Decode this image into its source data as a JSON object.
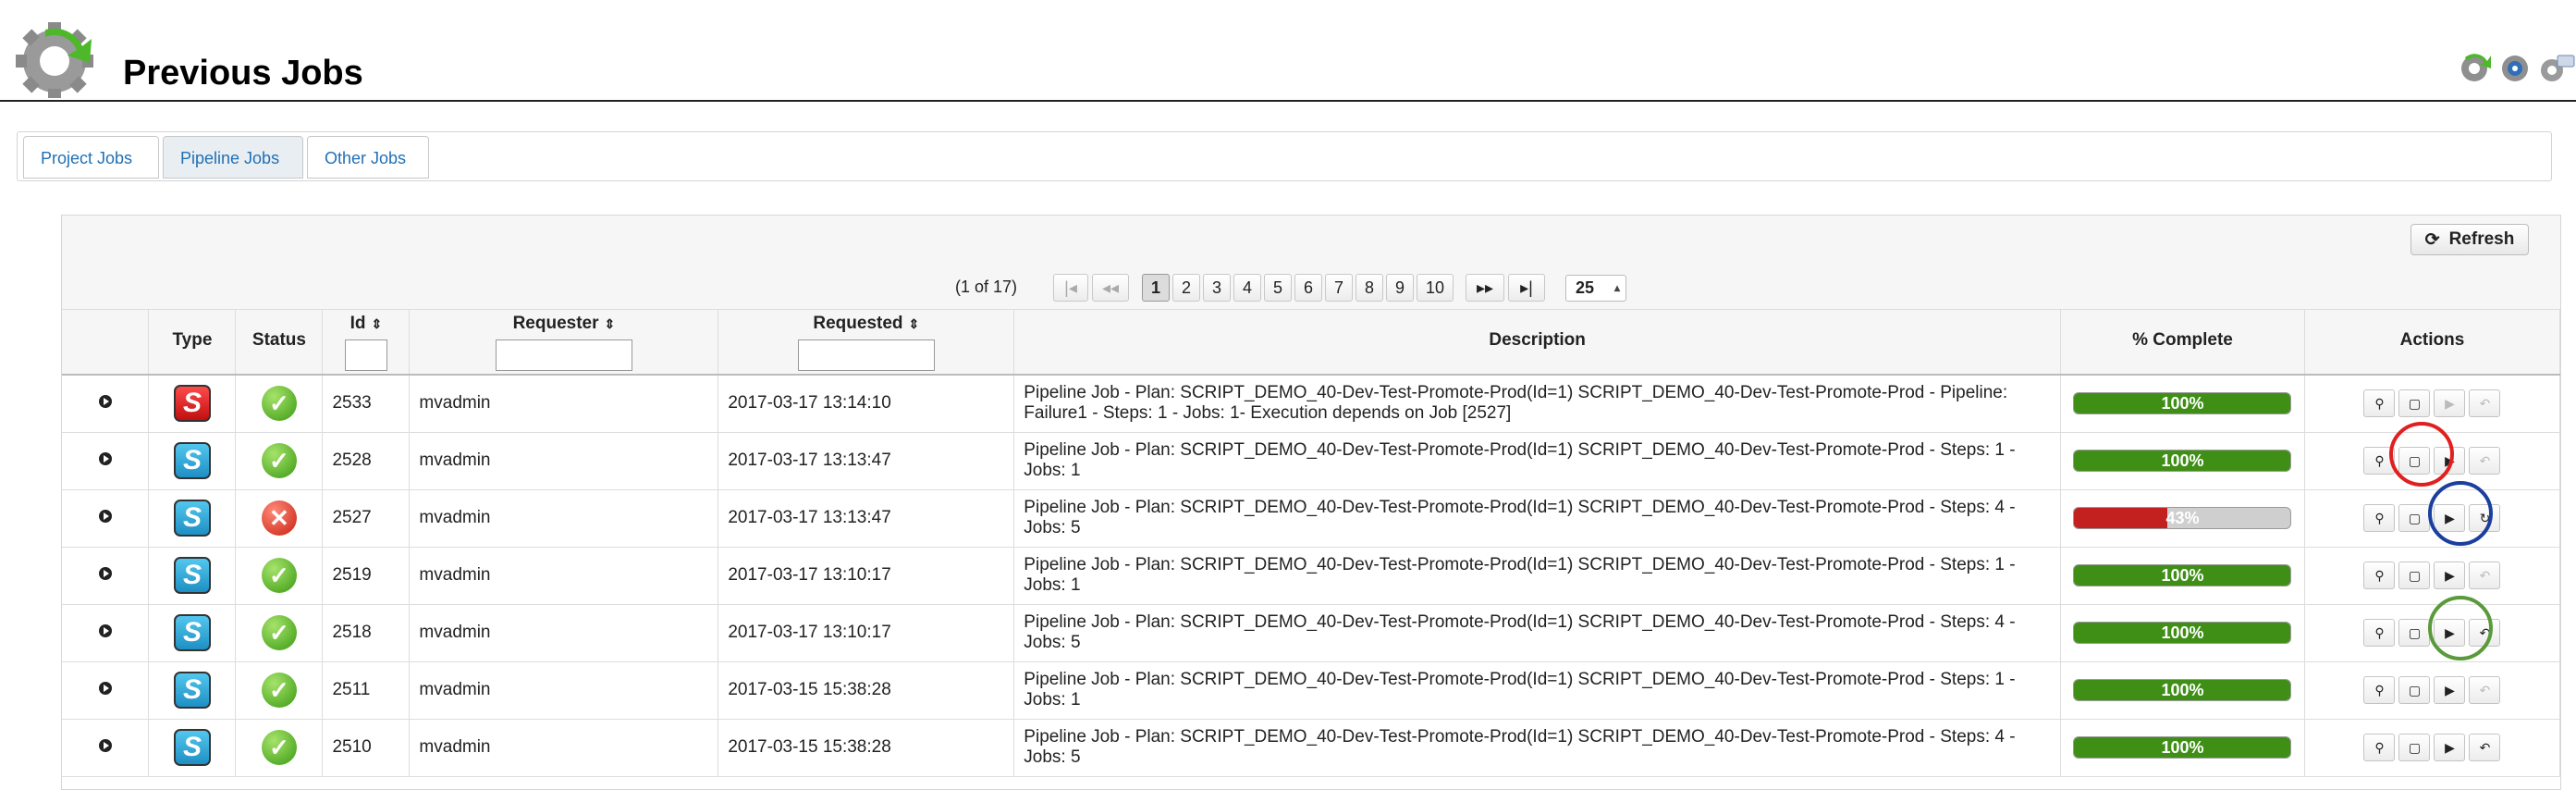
{
  "page": {
    "title": "Previous Jobs"
  },
  "tabs": [
    {
      "label": "Project Jobs",
      "active": false
    },
    {
      "label": "Pipeline Jobs",
      "active": true
    },
    {
      "label": "Other Jobs",
      "active": false
    }
  ],
  "toolbar": {
    "refresh_label": "Refresh"
  },
  "pager": {
    "report": "(1 of 17)",
    "pages": [
      "1",
      "2",
      "3",
      "4",
      "5",
      "6",
      "7",
      "8",
      "9",
      "10"
    ],
    "first": "|◂",
    "prev": "◂◂",
    "next": "▸▸",
    "last": "▸|",
    "rows_per_page": "25"
  },
  "columns": {
    "type": "Type",
    "status": "Status",
    "id": "Id",
    "requester": "Requester",
    "requested": "Requested",
    "description": "Description",
    "complete": "% Complete",
    "actions": "Actions"
  },
  "rows": [
    {
      "type_color": "red",
      "status": "ok",
      "id": "2533",
      "requester": "mvadmin",
      "requested": "2017-03-17 13:14:10",
      "description": "Pipeline Job - Plan: SCRIPT_DEMO_40-Dev-Test-Promote-Prod(Id=1) SCRIPT_DEMO_40-Dev-Test-Promote-Prod - Pipeline: Failure1 - Steps: 1 - Jobs: 1- Execution depends on Job [2527]",
      "progress_label": "100%",
      "progress": 100,
      "actions": [
        "view",
        "log",
        "run-disabled",
        "undo-disabled"
      ]
    },
    {
      "type_color": "blue",
      "status": "ok",
      "id": "2528",
      "requester": "mvadmin",
      "requested": "2017-03-17 13:13:47",
      "description": "Pipeline Job - Plan: SCRIPT_DEMO_40-Dev-Test-Promote-Prod(Id=1) SCRIPT_DEMO_40-Dev-Test-Promote-Prod - Steps: 1 - Jobs: 1",
      "progress_label": "100%",
      "progress": 100,
      "actions": [
        "view",
        "log",
        "run",
        "undo-disabled"
      ]
    },
    {
      "type_color": "blue",
      "status": "fail",
      "id": "2527",
      "requester": "mvadmin",
      "requested": "2017-03-17 13:13:47",
      "description": "Pipeline Job - Plan: SCRIPT_DEMO_40-Dev-Test-Promote-Prod(Id=1) SCRIPT_DEMO_40-Dev-Test-Promote-Prod - Steps: 4 - Jobs: 5",
      "progress_label": "43%",
      "progress": 43,
      "actions": [
        "view",
        "log",
        "run",
        "retry"
      ]
    },
    {
      "type_color": "blue",
      "status": "ok",
      "id": "2519",
      "requester": "mvadmin",
      "requested": "2017-03-17 13:10:17",
      "description": "Pipeline Job - Plan: SCRIPT_DEMO_40-Dev-Test-Promote-Prod(Id=1) SCRIPT_DEMO_40-Dev-Test-Promote-Prod - Steps: 1 - Jobs: 1",
      "progress_label": "100%",
      "progress": 100,
      "actions": [
        "view",
        "log",
        "run",
        "undo-disabled"
      ]
    },
    {
      "type_color": "blue",
      "status": "ok",
      "id": "2518",
      "requester": "mvadmin",
      "requested": "2017-03-17 13:10:17",
      "description": "Pipeline Job - Plan: SCRIPT_DEMO_40-Dev-Test-Promote-Prod(Id=1) SCRIPT_DEMO_40-Dev-Test-Promote-Prod - Steps: 4 - Jobs: 5",
      "progress_label": "100%",
      "progress": 100,
      "actions": [
        "view",
        "log",
        "run",
        "undo"
      ]
    },
    {
      "type_color": "blue",
      "status": "ok",
      "id": "2511",
      "requester": "mvadmin",
      "requested": "2017-03-15 15:38:28",
      "description": "Pipeline Job - Plan: SCRIPT_DEMO_40-Dev-Test-Promote-Prod(Id=1) SCRIPT_DEMO_40-Dev-Test-Promote-Prod - Steps: 1 - Jobs: 1",
      "progress_label": "100%",
      "progress": 100,
      "actions": [
        "view",
        "log",
        "run",
        "undo-disabled"
      ]
    },
    {
      "type_color": "blue",
      "status": "ok",
      "id": "2510",
      "requester": "mvadmin",
      "requested": "2017-03-15 15:38:28",
      "description": "Pipeline Job - Plan: SCRIPT_DEMO_40-Dev-Test-Promote-Prod(Id=1) SCRIPT_DEMO_40-Dev-Test-Promote-Prod - Steps: 4 - Jobs: 5",
      "progress_label": "100%",
      "progress": 100,
      "actions": [
        "view",
        "log",
        "run",
        "undo"
      ]
    }
  ],
  "annotation_colors": {
    "red": "#e02020",
    "blue": "#1a3f9e",
    "green": "#5a9a3a"
  }
}
